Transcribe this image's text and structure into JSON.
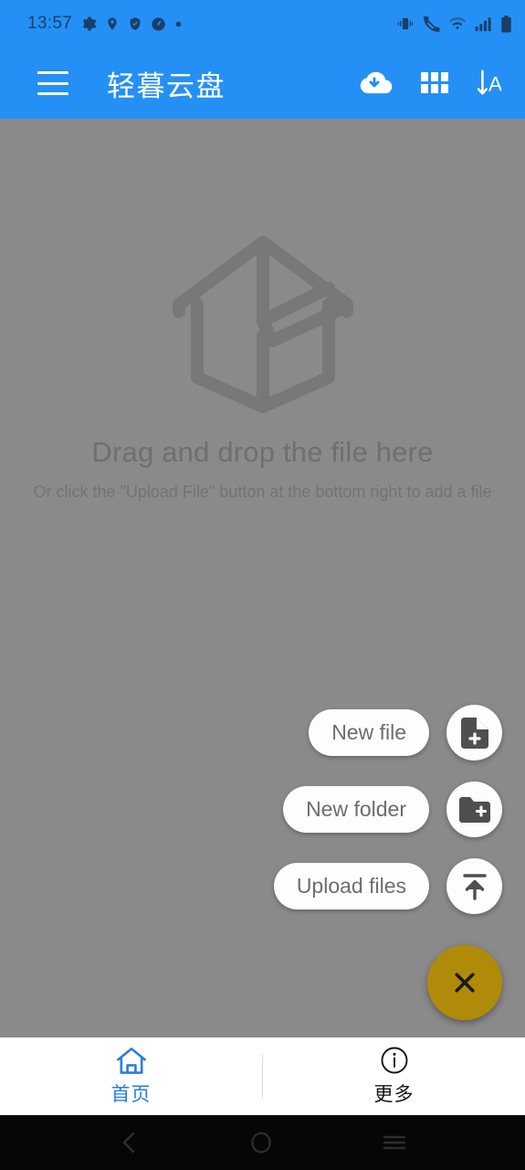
{
  "status_bar": {
    "time": "13:57",
    "left_icons": [
      "gear-icon",
      "location-pin-icon",
      "shield-check-icon",
      "speedometer-icon",
      "dot-icon"
    ],
    "right_icons": [
      "vibrate-icon",
      "call-muted-icon",
      "wifi-icon",
      "signal-bars-icon",
      "battery-icon"
    ],
    "text_color": "#1a3f66",
    "background": "#2490f5"
  },
  "app_bar": {
    "title": "轻暮云盘",
    "menu_icon": "hamburger-menu-icon",
    "background": "#2490f5",
    "title_color": "#ffffff",
    "actions": [
      {
        "name": "cloud-download-icon",
        "label": "Cloud download"
      },
      {
        "name": "grid-view-icon",
        "label": "Grid view"
      },
      {
        "name": "sort-alpha-icon",
        "label": "Sort A-Z"
      }
    ]
  },
  "empty_state": {
    "illustration": "open-box-icon",
    "title": "Drag and drop the file here",
    "subtitle": "Or click the \"Upload File\" button at the bottom right to add a file",
    "title_color": "#b9b9b9"
  },
  "speed_dial": {
    "expanded": true,
    "scrim_color": "rgba(66,66,66,0.62)",
    "fab_color": "#d4a017",
    "fab_icon": "close-x-icon",
    "actions": [
      {
        "label": "New file",
        "icon": "file-plus-icon"
      },
      {
        "label": "New folder",
        "icon": "folder-plus-icon"
      },
      {
        "label": "Upload files",
        "icon": "upload-arrow-icon"
      }
    ]
  },
  "bottom_nav": {
    "active_color": "#2b7de0",
    "inactive_color": "#141414",
    "items": [
      {
        "label": "首页",
        "icon": "home-icon",
        "active": true
      },
      {
        "label": "更多",
        "icon": "info-circle-icon",
        "active": false
      }
    ]
  },
  "android_nav": {
    "background": "#060606",
    "buttons": [
      "back-icon",
      "home-circle-icon",
      "recents-icon"
    ]
  }
}
